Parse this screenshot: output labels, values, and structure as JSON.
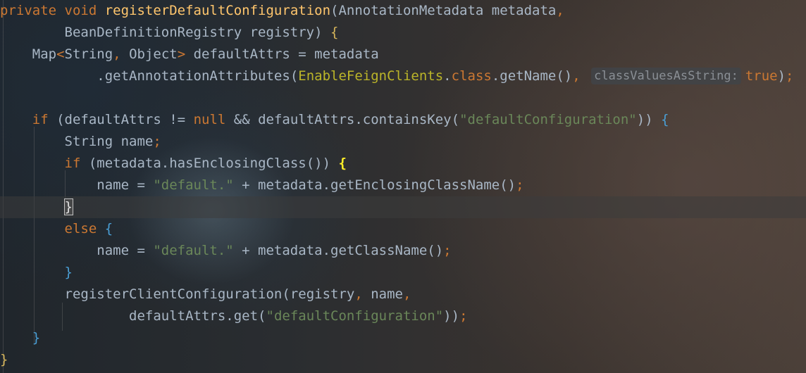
{
  "editor": {
    "theme": "dark",
    "colors": {
      "keyword": "#cc7832",
      "method": "#ffc66d",
      "annotation_class": "#bbb529",
      "string": "#6a8759",
      "default_text": "#a9b7c6",
      "brace_blue": "#4a9fd5"
    },
    "lines": [
      {
        "tokens": [
          [
            "kw",
            "private void "
          ],
          [
            "m",
            "registerDefaultConfiguration"
          ],
          [
            "p",
            "("
          ],
          [
            "ty",
            "AnnotationMetadata metadata"
          ],
          [
            "kw",
            ","
          ]
        ]
      },
      {
        "tokens": [
          [
            "ty",
            "        BeanDefinitionRegistry registry"
          ],
          [
            "p",
            ") "
          ],
          [
            "brace-yellow",
            "{"
          ]
        ]
      },
      {
        "tokens": [
          [
            "ty",
            "    Map"
          ],
          [
            "kw",
            "<"
          ],
          [
            "ty",
            "String"
          ],
          [
            "kw",
            ", "
          ],
          [
            "ty",
            "Object"
          ],
          [
            "kw",
            "> "
          ],
          [
            "ty",
            "defaultAttrs = metadata"
          ]
        ]
      },
      {
        "tokens": [
          [
            "ty",
            "            .getAnnotationAttributes"
          ],
          [
            "p",
            "("
          ],
          [
            "cls",
            "EnableFeignClients"
          ],
          [
            "ty",
            "."
          ],
          [
            "kw",
            "class"
          ],
          [
            "ty",
            ".getName()"
          ],
          [
            "kw",
            ", "
          ],
          [
            "hint",
            "classValuesAsString:"
          ],
          [
            "kw",
            "true"
          ],
          [
            "p",
            ")"
          ],
          [
            "kw",
            ";"
          ]
        ]
      },
      {
        "tokens": [
          [
            "ty",
            ""
          ]
        ]
      },
      {
        "tokens": [
          [
            "kw",
            "    if "
          ],
          [
            "p",
            "("
          ],
          [
            "ty",
            "defaultAttrs != "
          ],
          [
            "kw",
            "null "
          ],
          [
            "ty",
            "&& defaultAttrs.containsKey"
          ],
          [
            "p",
            "("
          ],
          [
            "str",
            "\"defaultConfiguration\""
          ],
          [
            "p",
            "))"
          ],
          [
            "ty",
            " "
          ],
          [
            "brace-blue",
            "{"
          ]
        ]
      },
      {
        "tokens": [
          [
            "ty",
            "        String name"
          ],
          [
            "kw",
            ";"
          ]
        ]
      },
      {
        "tokens": [
          [
            "kw",
            "        if "
          ],
          [
            "p",
            "("
          ],
          [
            "ty",
            "metadata.hasEnclosingClass()"
          ],
          [
            "p",
            ") "
          ],
          [
            "brace-bold",
            "{"
          ]
        ]
      },
      {
        "tokens": [
          [
            "ty",
            "            name = "
          ],
          [
            "str",
            "\"default.\""
          ],
          [
            "ty",
            " + metadata.getEnclosingClassName()"
          ],
          [
            "kw",
            ";"
          ]
        ]
      },
      {
        "tokens": [
          [
            "ty",
            "        "
          ],
          [
            "brace-box",
            "}"
          ]
        ],
        "current": true
      },
      {
        "tokens": [
          [
            "kw",
            "        else "
          ],
          [
            "brace-blue",
            "{"
          ]
        ]
      },
      {
        "tokens": [
          [
            "ty",
            "            name = "
          ],
          [
            "str",
            "\"default.\""
          ],
          [
            "ty",
            " + metadata.getClassName()"
          ],
          [
            "kw",
            ";"
          ]
        ]
      },
      {
        "tokens": [
          [
            "ty",
            "        "
          ],
          [
            "brace-blue",
            "}"
          ]
        ]
      },
      {
        "tokens": [
          [
            "ty",
            "        registerClientConfiguration"
          ],
          [
            "p",
            "("
          ],
          [
            "ty",
            "registry"
          ],
          [
            "kw",
            ", "
          ],
          [
            "ty",
            "name"
          ],
          [
            "kw",
            ","
          ]
        ]
      },
      {
        "tokens": [
          [
            "ty",
            "                defaultAttrs.get"
          ],
          [
            "p",
            "("
          ],
          [
            "str",
            "\"defaultConfiguration\""
          ],
          [
            "p",
            "))"
          ],
          [
            "kw",
            ";"
          ]
        ]
      },
      {
        "tokens": [
          [
            "ty",
            "    "
          ],
          [
            "brace-blue",
            "}"
          ]
        ]
      },
      {
        "tokens": [
          [
            "brace-yellow",
            "}"
          ]
        ]
      }
    ]
  }
}
